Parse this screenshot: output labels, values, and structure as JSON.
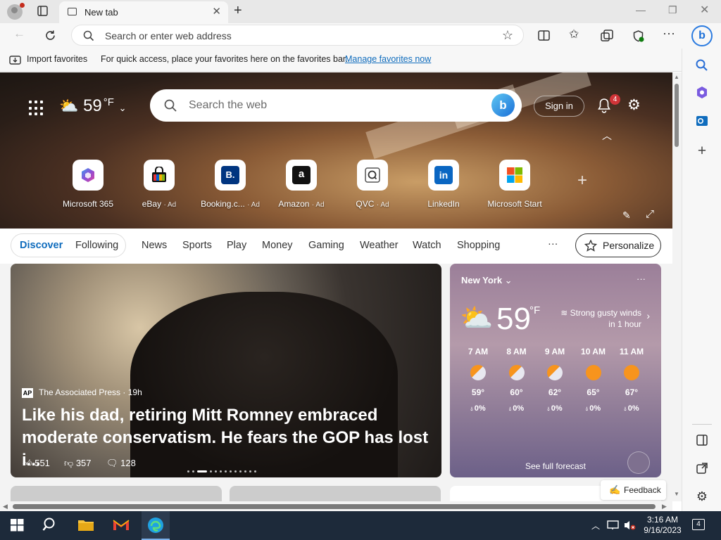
{
  "tab": {
    "title": "New tab"
  },
  "address": {
    "placeholder": "Search or enter web address"
  },
  "favbar": {
    "import_label": "Import favorites",
    "message": "For quick access, place your favorites here on the favorites bar.",
    "link": "Manage favorites now"
  },
  "hero": {
    "temperature": "59",
    "unit": "°F",
    "search_placeholder": "Search the web",
    "signin": "Sign in",
    "notification_count": "4"
  },
  "quick_links": [
    {
      "label": "Microsoft 365",
      "ad": "",
      "icon": "microsoft-365-icon"
    },
    {
      "label": "eBay",
      "ad": "· Ad",
      "icon": "ebay-icon"
    },
    {
      "label": "Booking.c...",
      "ad": "· Ad",
      "icon": "booking-icon"
    },
    {
      "label": "Amazon",
      "ad": "· Ad",
      "icon": "amazon-icon"
    },
    {
      "label": "QVC",
      "ad": "· Ad",
      "icon": "qvc-icon"
    },
    {
      "label": "LinkedIn",
      "ad": "",
      "icon": "linkedin-icon"
    },
    {
      "label": "Microsoft Start",
      "ad": "",
      "icon": "microsoft-start-icon"
    }
  ],
  "nav": {
    "tabs": [
      "Discover",
      "Following"
    ],
    "items": [
      "News",
      "Sports",
      "Play",
      "Money",
      "Gaming",
      "Weather",
      "Watch",
      "Shopping"
    ],
    "more": "···",
    "personalize": "Personalize"
  },
  "news": {
    "source": "The Associated Press · 19h",
    "source_logo": "AP",
    "headline": "Like his dad, retiring Mitt Romney embraced moderate conservatism. He fears the GOP has lost i...",
    "likes": "551",
    "dislikes": "357",
    "comments": "128"
  },
  "weather": {
    "city": "New York",
    "temperature": "59",
    "unit": "°F",
    "alert": "Strong gusty winds in 1 hour",
    "hourly": [
      {
        "time": "7 AM",
        "temp": "59°",
        "precip": "0%",
        "icon": "partly-cloudy-icon"
      },
      {
        "time": "8 AM",
        "temp": "60°",
        "precip": "0%",
        "icon": "partly-cloudy-icon"
      },
      {
        "time": "9 AM",
        "temp": "62°",
        "precip": "0%",
        "icon": "partly-cloudy-icon"
      },
      {
        "time": "10 AM",
        "temp": "65°",
        "precip": "0%",
        "icon": "sun-icon"
      },
      {
        "time": "11 AM",
        "temp": "67°",
        "precip": "0%",
        "icon": "sun-icon"
      }
    ],
    "see_forecast": "See full forecast"
  },
  "feedback": "Feedback",
  "taskbar": {
    "time": "3:16 AM",
    "date": "9/16/2023",
    "notification_count": "4"
  },
  "colors": {
    "accent": "#0f6cbd",
    "taskbar": "#1d2a3a"
  }
}
